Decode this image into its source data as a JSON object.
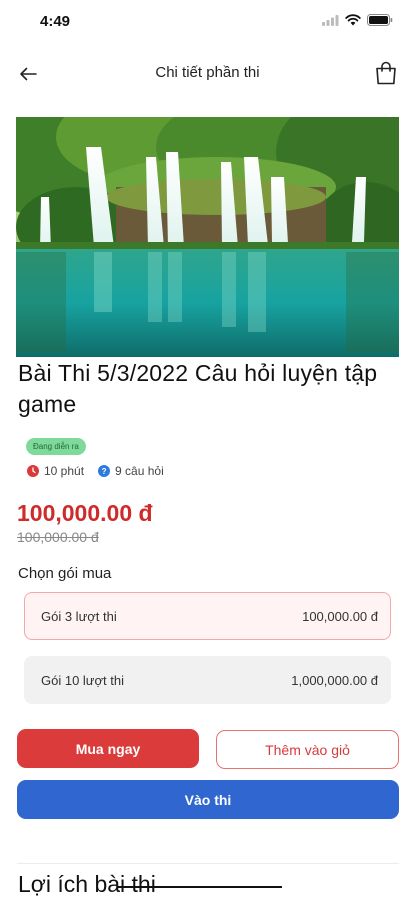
{
  "status_bar": {
    "time": "4:49",
    "icons": [
      "signal-icon",
      "wifi-icon",
      "battery-icon"
    ]
  },
  "nav": {
    "title": "Chi tiết phần thi",
    "back_icon": "arrow-left-icon",
    "cart_icon": "shopping-bag-icon"
  },
  "hero": {
    "image_alt": "waterfall landscape photo"
  },
  "exam": {
    "title": "Bài Thi 5/3/2022 Câu hỏi luyện tập game",
    "status": "Đang diễn ra",
    "duration": "10 phút",
    "questions": "9 câu hỏi",
    "price": "100,000.00 đ",
    "old_price": "100,000.00 đ"
  },
  "packages": {
    "label": "Chọn gói mua",
    "items": [
      {
        "name": "Gói 3 lượt thi",
        "price": "100,000.00 đ",
        "selected": true
      },
      {
        "name": "Gói 10 lượt thi",
        "price": "1,000,000.00 đ",
        "selected": false
      }
    ]
  },
  "actions": {
    "buy_now": "Mua ngay",
    "add_to_cart": "Thêm vào giỏ",
    "enter_exam": "Vào thi"
  },
  "benefits": {
    "title": "Lợi ích bài thi"
  },
  "colors": {
    "primary_red": "#db3b3b",
    "primary_blue": "#2f66cf",
    "badge_green": "#7fd99a"
  }
}
